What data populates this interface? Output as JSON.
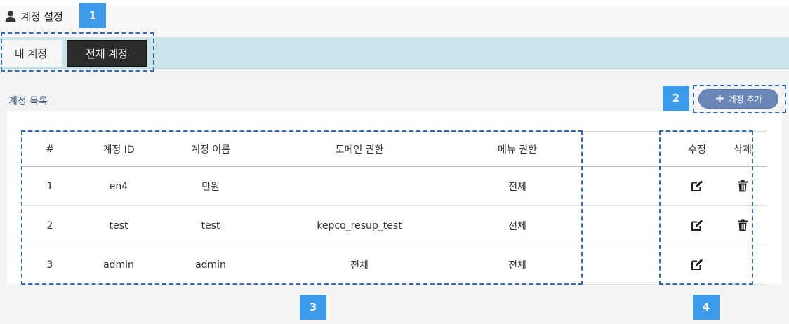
{
  "header": {
    "title": "계정 설정",
    "icon": "user-icon"
  },
  "tabs": [
    {
      "label": "내 계정",
      "active": false
    },
    {
      "label": "전체 계정",
      "active": true
    }
  ],
  "section": {
    "title": "계정 목록"
  },
  "add_button": {
    "label": "계정 추가",
    "icon": "plus-icon"
  },
  "table": {
    "headers": [
      "#",
      "계정 ID",
      "계정 이름",
      "도메인 권한",
      "메뉴 권한",
      "",
      "수정",
      "삭제"
    ],
    "rows": [
      {
        "num": "1",
        "id": "en4",
        "name": "민원",
        "domain": "",
        "menu": "전체",
        "editable": true,
        "deletable": true
      },
      {
        "num": "2",
        "id": "test",
        "name": "test",
        "domain": "kepco_resup_test",
        "menu": "전체",
        "editable": true,
        "deletable": true
      },
      {
        "num": "3",
        "id": "admin",
        "name": "admin",
        "domain": "전체",
        "menu": "전체",
        "editable": true,
        "deletable": false
      }
    ]
  },
  "annotations": [
    "1",
    "2",
    "3",
    "4"
  ],
  "colors": {
    "accent": "#3d9ae8",
    "tab_active": "#2b2b2b",
    "tab_bar": "#cbe5ea",
    "add_button": "#6a87b8",
    "dash": "#2f6db5"
  }
}
